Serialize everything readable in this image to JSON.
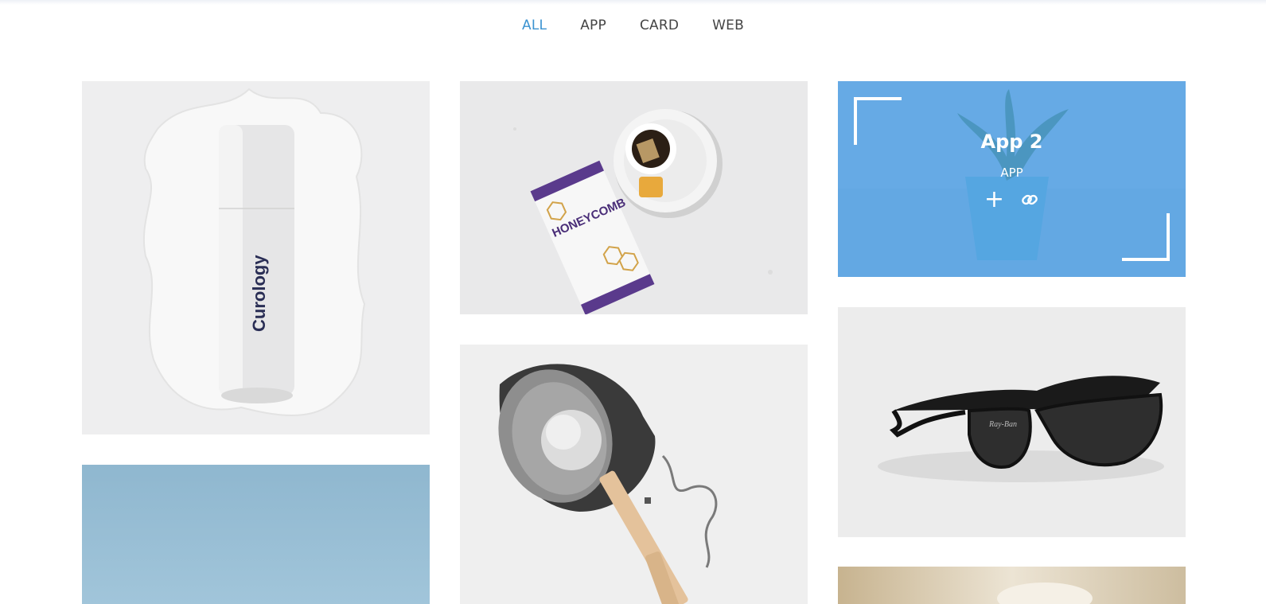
{
  "filters": [
    {
      "label": "ALL",
      "active": true
    },
    {
      "label": "APP",
      "active": false
    },
    {
      "label": "CARD",
      "active": false
    },
    {
      "label": "WEB",
      "active": false
    }
  ],
  "portfolio": {
    "hover_item": {
      "title": "App 2",
      "category": "APP",
      "zoom_icon": "plus-icon",
      "link_icon": "link-icon"
    },
    "product_texts": {
      "bottle_brand": "Curology",
      "tea_label": "HONEYCOMB",
      "sunglasses_brand": "Ray-Ban"
    }
  },
  "colors": {
    "accent": "#3b93d1",
    "overlay": "#52a0e0",
    "text": "#444444"
  }
}
